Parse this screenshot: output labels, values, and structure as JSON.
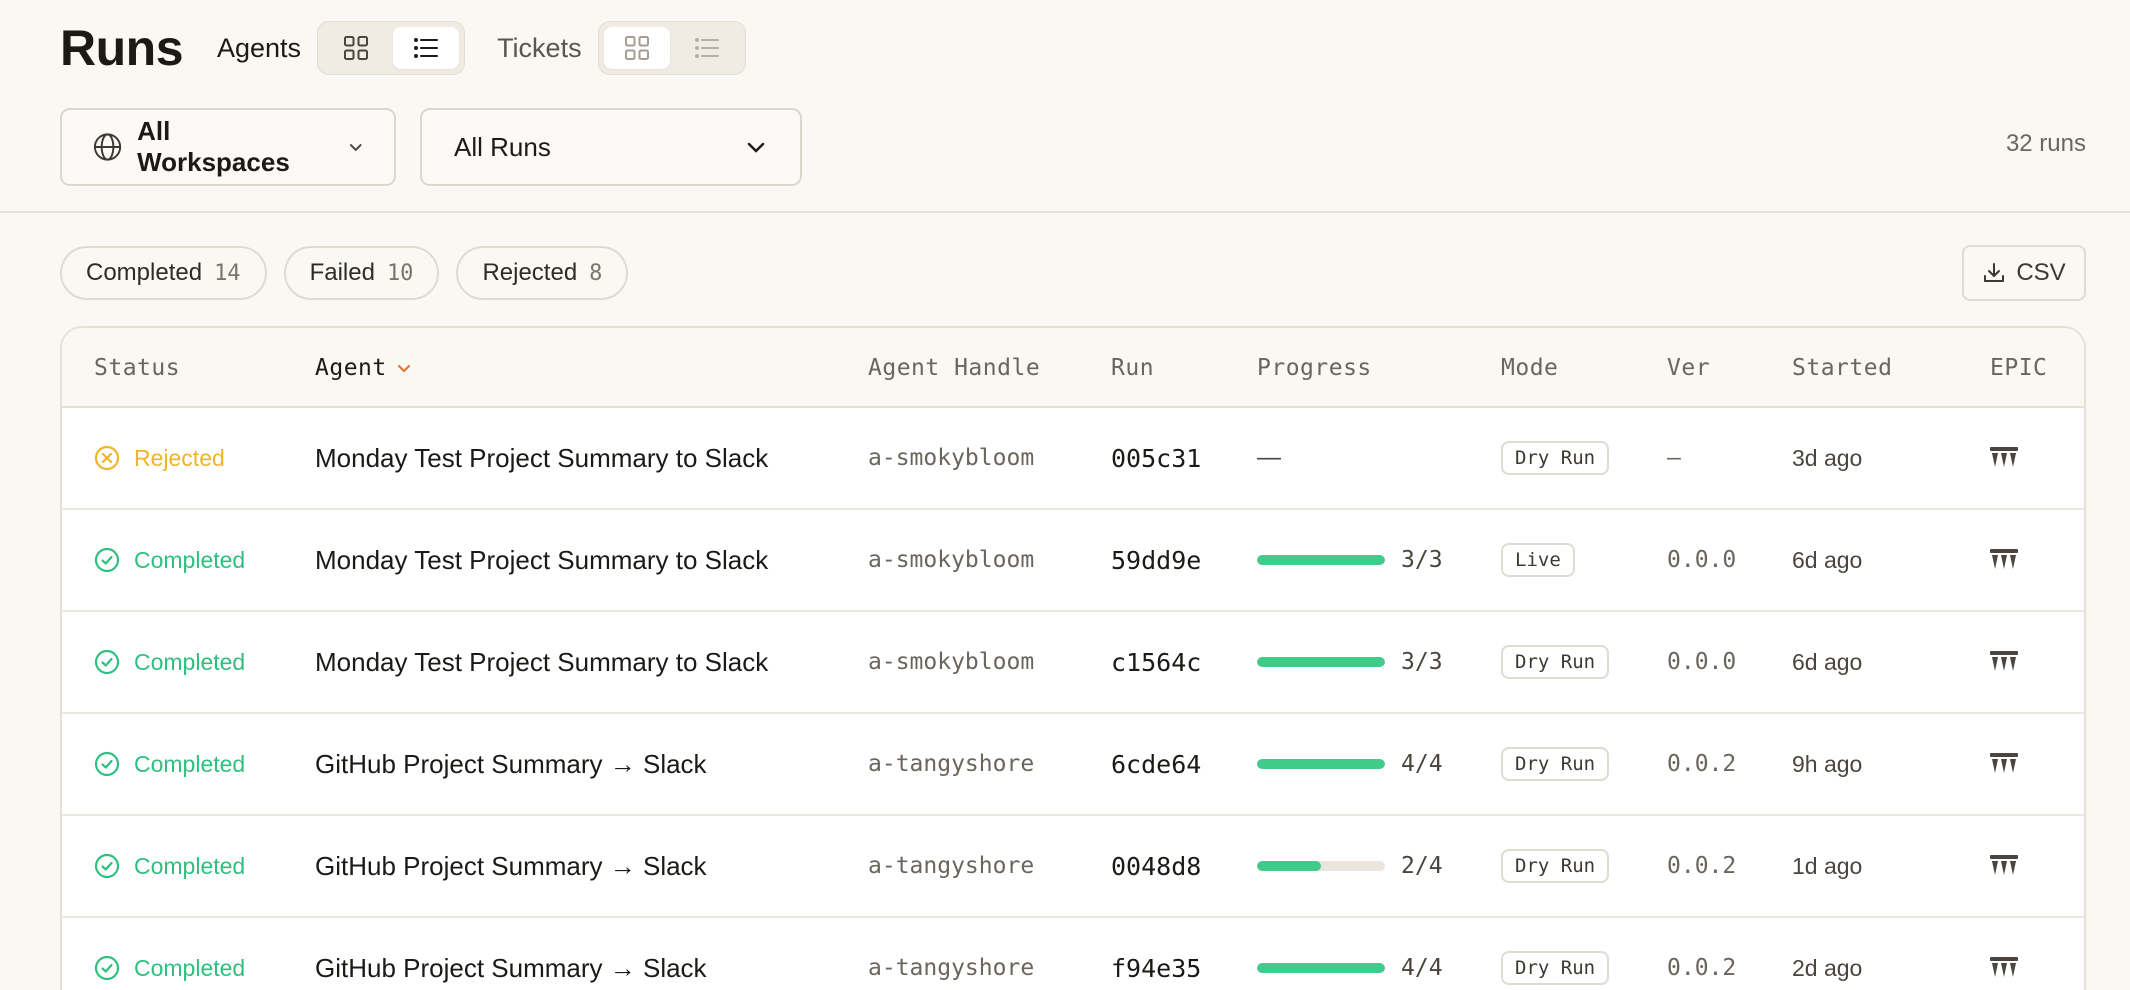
{
  "header": {
    "title": "Runs",
    "agents_label": "Agents",
    "tickets_label": "Tickets"
  },
  "filters": {
    "workspace": "All Workspaces",
    "runs": "All Runs",
    "run_count": "32 runs"
  },
  "chips": [
    {
      "label": "Completed",
      "count": "14"
    },
    {
      "label": "Failed",
      "count": "10"
    },
    {
      "label": "Rejected",
      "count": "8"
    }
  ],
  "csv_label": "CSV",
  "columns": {
    "status": "Status",
    "agent": "Agent",
    "handle": "Agent Handle",
    "run": "Run",
    "progress": "Progress",
    "mode": "Mode",
    "ver": "Ver",
    "started": "Started",
    "epic": "EPIC"
  },
  "colors": {
    "completed": "#2fbf7f",
    "rejected": "#f0b429",
    "progress_fill": "#3fcc8b",
    "sort_accent": "#e8743b"
  },
  "rows": [
    {
      "status": "Rejected",
      "status_kind": "rejected",
      "agent": "Monday Test Project Summary to Slack",
      "handle": "a-smokybloom",
      "run": "005c31",
      "progress_text": "—",
      "progress_fraction": null,
      "mode": "Dry Run",
      "ver": "–",
      "started": "3d ago"
    },
    {
      "status": "Completed",
      "status_kind": "completed",
      "agent": "Monday Test Project Summary to Slack",
      "handle": "a-smokybloom",
      "run": "59dd9e",
      "progress_text": "3/3",
      "progress_fraction": 1.0,
      "mode": "Live",
      "ver": "0.0.0",
      "started": "6d ago"
    },
    {
      "status": "Completed",
      "status_kind": "completed",
      "agent": "Monday Test Project Summary to Slack",
      "handle": "a-smokybloom",
      "run": "c1564c",
      "progress_text": "3/3",
      "progress_fraction": 1.0,
      "mode": "Dry Run",
      "ver": "0.0.0",
      "started": "6d ago"
    },
    {
      "status": "Completed",
      "status_kind": "completed",
      "agent": "GitHub Project Summary → Slack",
      "handle": "a-tangyshore",
      "run": "6cde64",
      "progress_text": "4/4",
      "progress_fraction": 1.0,
      "mode": "Dry Run",
      "ver": "0.0.2",
      "started": "9h ago"
    },
    {
      "status": "Completed",
      "status_kind": "completed",
      "agent": "GitHub Project Summary → Slack",
      "handle": "a-tangyshore",
      "run": "0048d8",
      "progress_text": "2/4",
      "progress_fraction": 0.5,
      "mode": "Dry Run",
      "ver": "0.0.2",
      "started": "1d ago"
    },
    {
      "status": "Completed",
      "status_kind": "completed",
      "agent": "GitHub Project Summary → Slack",
      "handle": "a-tangyshore",
      "run": "f94e35",
      "progress_text": "4/4",
      "progress_fraction": 1.0,
      "mode": "Dry Run",
      "ver": "0.0.2",
      "started": "2d ago"
    }
  ]
}
